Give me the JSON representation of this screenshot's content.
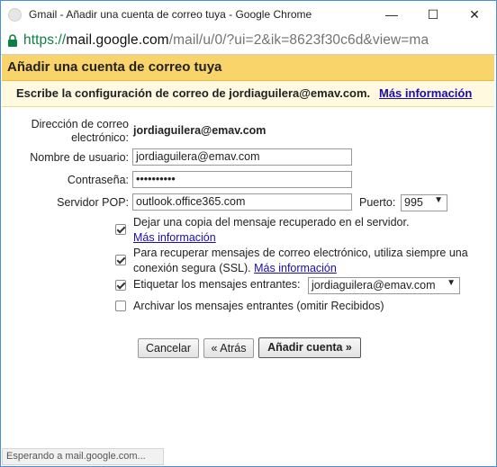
{
  "window": {
    "title": "Gmail - Añadir una cuenta de correo tuya - Google Chrome",
    "minimize_glyph": "—",
    "maximize_glyph": "☐",
    "close_glyph": "✕"
  },
  "address_bar": {
    "scheme": "https://",
    "host": "mail.google.com",
    "path": "/mail/u/0/?ui=2&ik=8623f30c6d&view=ma"
  },
  "page": {
    "title": "Añadir una cuenta de correo tuya",
    "subtitle": "Escribe la configuración de correo de jordiaguilera@emav.com.",
    "subtitle_link": "Más información"
  },
  "form": {
    "email_label": "Dirección de correo electrónico:",
    "email_value": "jordiaguilera@emav.com",
    "username_label": "Nombre de usuario:",
    "username_value": "jordiaguilera@emav.com",
    "password_label": "Contraseña:",
    "password_value": "••••••••••",
    "pop_server_label": "Servidor POP:",
    "pop_server_value": "outlook.office365.com",
    "port_label": "Puerto:",
    "port_value": "995",
    "options": [
      {
        "label": "Dejar una copia del mensaje recuperado en el servidor.",
        "link": "Más información",
        "checked": true
      },
      {
        "label": "Para recuperar mensajes de correo electrónico, utiliza siempre una conexión segura (SSL).",
        "link": "Más información",
        "checked": true
      },
      {
        "label": "Etiquetar los mensajes entrantes:",
        "select_value": "jordiaguilera@emav.com",
        "checked": true
      },
      {
        "label": "Archivar los mensajes entrantes (omitir Recibidos)",
        "checked": false
      }
    ]
  },
  "buttons": {
    "cancel": "Cancelar",
    "back": "« Atrás",
    "add_account": "Añadir cuenta »"
  },
  "status_bar": {
    "text": "Esperando a mail.google.com..."
  },
  "colors": {
    "header_bg": "#f9d46b",
    "subtitle_bg": "#fff9e0",
    "link": "#1a0dab",
    "secure_scheme": "#0b8043",
    "window_border": "#4a90d9"
  }
}
